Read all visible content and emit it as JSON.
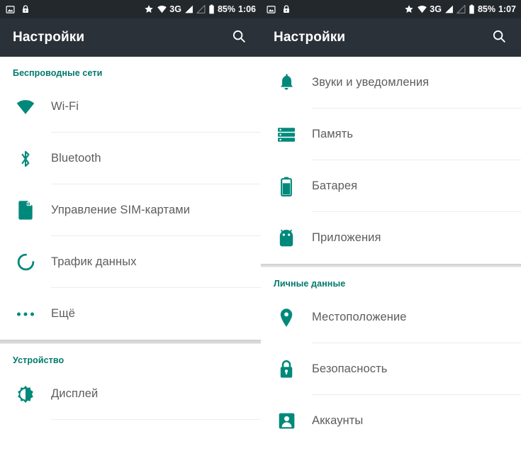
{
  "accent_color": "#00897b",
  "section_header_color": "#00796b",
  "row_label_color": "#5d5d5d",
  "statusbar_color": "#23282d",
  "appbar_color": "#2b3139",
  "screens": [
    {
      "id": "settings-page-1",
      "statusbar": {
        "left_icons": [
          "image-icon",
          "lock-icon"
        ],
        "network_label": "3G",
        "battery_percent": "85%",
        "time": "1:06",
        "right_icons": [
          "star-icon",
          "wifi-icon",
          "signal-icon",
          "signal-secondary-icon",
          "battery-icon"
        ]
      },
      "appbar": {
        "title": "Настройки",
        "action_icon": "search-icon"
      },
      "sections": [
        {
          "header": "Беспроводные сети",
          "items": [
            {
              "label": "Wi-Fi",
              "icon": "wifi-icon"
            },
            {
              "label": "Bluetooth",
              "icon": "bluetooth-icon"
            },
            {
              "label": "Управление SIM-картами",
              "icon": "sim-card-icon"
            },
            {
              "label": "Трафик данных",
              "icon": "data-usage-icon"
            },
            {
              "label": "Ещё",
              "icon": "more-icon"
            }
          ]
        },
        {
          "header": "Устройство",
          "items": [
            {
              "label": "Дисплей",
              "icon": "brightness-icon"
            }
          ]
        }
      ]
    },
    {
      "id": "settings-page-2",
      "statusbar": {
        "left_icons": [
          "image-icon",
          "lock-icon"
        ],
        "network_label": "3G",
        "battery_percent": "85%",
        "time": "1:07",
        "right_icons": [
          "star-icon",
          "wifi-icon",
          "signal-icon",
          "signal-secondary-icon",
          "battery-icon"
        ]
      },
      "appbar": {
        "title": "Настройки",
        "action_icon": "search-icon"
      },
      "sections": [
        {
          "header": "",
          "items": [
            {
              "label": "Звуки и уведомления",
              "icon": "bell-icon"
            },
            {
              "label": "Память",
              "icon": "storage-icon"
            },
            {
              "label": "Батарея",
              "icon": "battery-icon"
            },
            {
              "label": "Приложения",
              "icon": "android-icon"
            }
          ]
        },
        {
          "header": "Личные данные",
          "items": [
            {
              "label": "Местоположение",
              "icon": "location-pin-icon"
            },
            {
              "label": "Безопасность",
              "icon": "lock-icon"
            },
            {
              "label": "Аккаунты",
              "icon": "account-icon"
            }
          ]
        }
      ]
    }
  ]
}
